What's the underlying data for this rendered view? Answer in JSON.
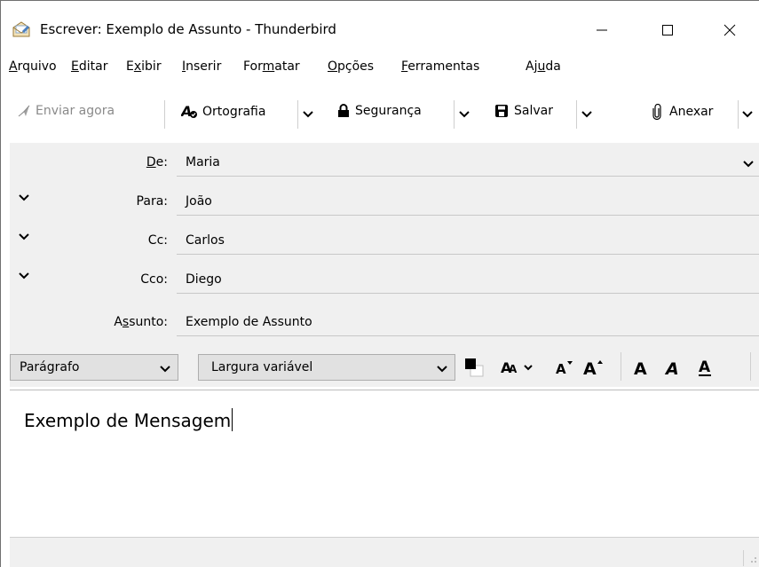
{
  "window": {
    "title": "Escrever: Exemplo de Assunto - Thunderbird",
    "minimize_glyph": "—",
    "maximize_glyph": "☐",
    "close_glyph": "✕"
  },
  "menu": {
    "items": [
      {
        "pre": "",
        "key": "A",
        "post": "rquivo"
      },
      {
        "pre": "",
        "key": "E",
        "post": "ditar"
      },
      {
        "pre": "E",
        "key": "x",
        "post": "ibir"
      },
      {
        "pre": "",
        "key": "I",
        "post": "nserir"
      },
      {
        "pre": "For",
        "key": "m",
        "post": "atar"
      },
      {
        "pre": "",
        "key": "O",
        "post": "pções"
      },
      {
        "pre": "",
        "key": "F",
        "post": "erramentas"
      },
      {
        "pre": "Aj",
        "key": "u",
        "post": "da"
      }
    ]
  },
  "toolbar": {
    "send_label": "Enviar agora",
    "spell_label": "Ortografia",
    "security_label": "Segurança",
    "save_label": "Salvar",
    "attach_label": "Anexar"
  },
  "header": {
    "from": {
      "label_key": "D",
      "label_rest": "e:",
      "value": "Maria"
    },
    "to": {
      "label": "Para:",
      "value": "João"
    },
    "cc": {
      "label": "Cc:",
      "value": "Carlos"
    },
    "bcc": {
      "label": "Cco:",
      "value": "Diego"
    },
    "subject": {
      "label_pre": "A",
      "label_key": "s",
      "label_rest": "sunto:",
      "value": "Exemplo de Assunto"
    }
  },
  "format": {
    "paragraph_value": "Parágrafo",
    "font_value": "Largura variável",
    "text_color": "#000000",
    "bg_color": "#ffffff"
  },
  "editor": {
    "body_text": "Exemplo de Mensagem"
  }
}
